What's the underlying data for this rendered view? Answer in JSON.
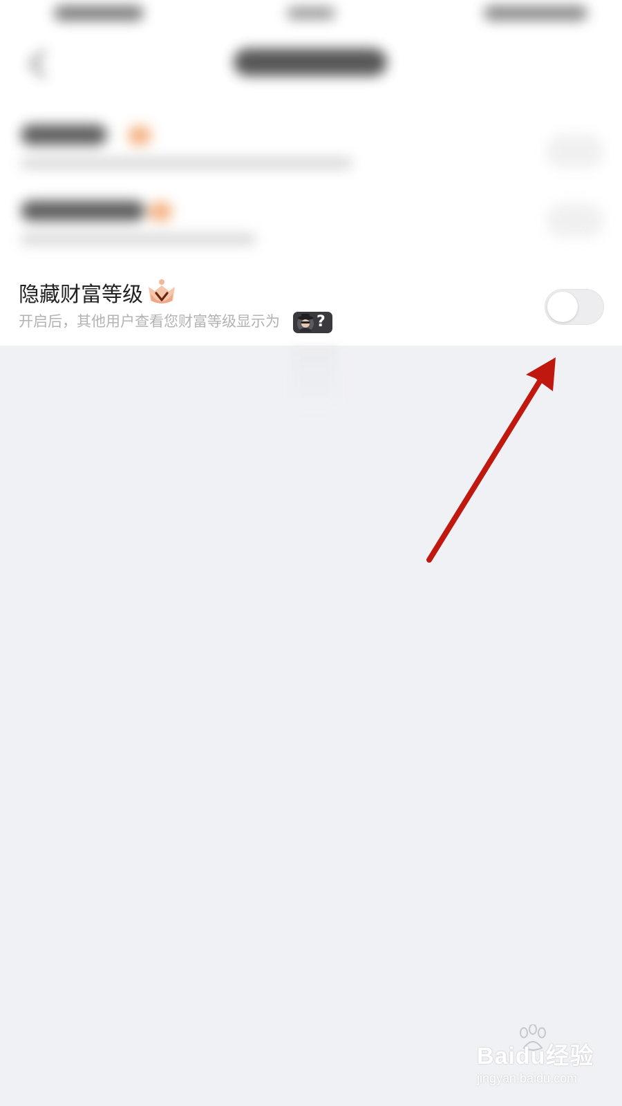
{
  "setting": {
    "title": "隐藏财富等级",
    "description": "开启后，其他用户查看您财富等级显示为",
    "badge_text": "?",
    "toggle_on": false
  },
  "icons": {
    "crown": "crown-v-icon",
    "mystery_avatar": "hooded-avatar-icon",
    "back": "chevron-left-icon"
  },
  "colors": {
    "background": "#f0f1f5",
    "card": "#ffffff",
    "title_text": "#222222",
    "desc_text": "#b2b2b7",
    "toggle_track": "#ededf0",
    "annotation_arrow": "#c0180e"
  },
  "watermark": {
    "brand": "Baidu经验",
    "url": "jingyan.baidu.com"
  }
}
